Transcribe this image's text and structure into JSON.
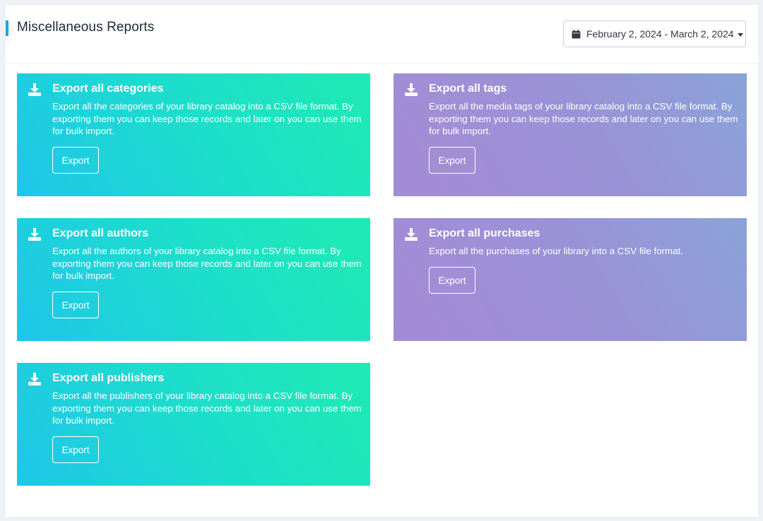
{
  "page": {
    "title": "Miscellaneous Reports",
    "date_range": "February 2, 2024 - March 2, 2024"
  },
  "cards": [
    {
      "title": "Export all categories",
      "description": "Export all the categories of your library catalog into a CSV file format. By exporting them you can keep those records and later on you can use them for bulk import.",
      "button": "Export",
      "theme": "green",
      "icon": "download-icon"
    },
    {
      "title": "Export all tags",
      "description": "Export all the media tags of your library catalog into a CSV file format. By exporting them you can keep those records and later on you can use them for bulk import.",
      "button": "Export",
      "theme": "purple",
      "icon": "download-icon"
    },
    {
      "title": "Export all authors",
      "description": "Export all the authors of your library catalog into a CSV file format. By exporting them you can keep those records and later on you can use them for bulk import.",
      "button": "Export",
      "theme": "green",
      "icon": "download-icon"
    },
    {
      "title": "Export all purchases",
      "description": "Export all the purchases of your library into a CSV file format.",
      "button": "Export",
      "theme": "purple",
      "icon": "download-icon"
    },
    {
      "title": "Export all publishers",
      "description": "Export all the publishers of your library catalog into a CSV file format. By exporting them you can keep those records and later on you can use them for bulk import.",
      "button": "Export",
      "theme": "green",
      "icon": "download-icon"
    }
  ],
  "colors": {
    "accent": "#1fa3e8",
    "green_start": "#1ec6ea",
    "green_end": "#1eeab3",
    "purple_start": "#a48bd6",
    "purple_end": "#8aa3d8"
  }
}
